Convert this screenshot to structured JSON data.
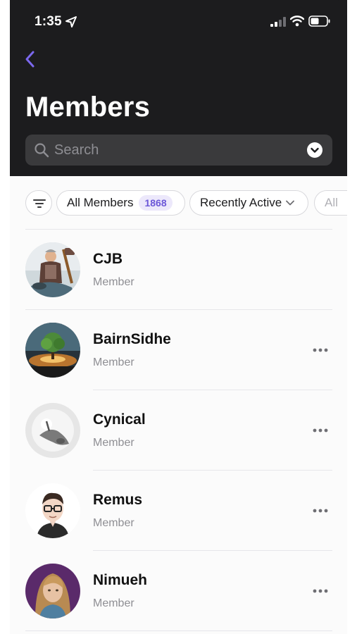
{
  "status_bar": {
    "time": "1:35",
    "icons": [
      "location-arrow-icon",
      "cellular-signal-icon",
      "wifi-icon",
      "battery-icon"
    ]
  },
  "header": {
    "back_icon": "chevron-left-icon",
    "title": "Members"
  },
  "search": {
    "placeholder": "Search",
    "icon": "search-icon",
    "dropdown_icon": "chevron-down-circle-icon"
  },
  "filters": {
    "filter_icon": "filter-lines-icon",
    "all_members_label": "All Members",
    "all_members_count": "1868",
    "sort_label": "Recently Active",
    "partial_chip_label": "All"
  },
  "members": [
    {
      "name": "CJB",
      "role": "Member",
      "has_more": false
    },
    {
      "name": "BairnSidhe",
      "role": "Member",
      "has_more": true
    },
    {
      "name": "Cynical",
      "role": "Member",
      "has_more": true
    },
    {
      "name": "Remus",
      "role": "Member",
      "has_more": true
    },
    {
      "name": "Nimueh",
      "role": "Member",
      "has_more": true
    }
  ],
  "colors": {
    "header_bg": "#1c1c1e",
    "accent": "#6b57d8",
    "count_badge_bg": "#ece8fb",
    "secondary_text": "#8e8e93"
  }
}
